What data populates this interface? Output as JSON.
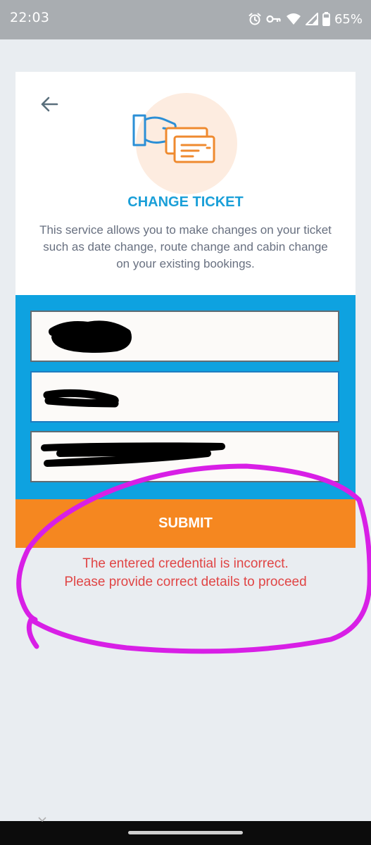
{
  "status_bar": {
    "time": "22:03",
    "battery": "65%",
    "icons": [
      "alarm-icon",
      "vpn-key-icon",
      "wifi-icon",
      "signal-icon",
      "battery-icon"
    ]
  },
  "card": {
    "title": "CHANGE TICKET",
    "description": "This service allows you to make changes on your ticket such as date change, route change and cabin change on your existing bookings.",
    "icons": [
      "back-arrow-icon",
      "hand-ticket-icon"
    ]
  },
  "form": {
    "fields": [
      {
        "value": "",
        "redacted": true
      },
      {
        "value": "",
        "redacted": true
      },
      {
        "value": "",
        "redacted": true
      }
    ],
    "submit_label": "SUBMIT"
  },
  "error": {
    "line1": "The entered credential is incorrect.",
    "line2": "Please provide correct details to proceed"
  },
  "colors": {
    "accent_blue": "#0ea2e0",
    "title_blue": "#1a9fd8",
    "submit_orange": "#f58720",
    "error_red": "#e04545",
    "annotation_magenta": "#d81fe6"
  }
}
